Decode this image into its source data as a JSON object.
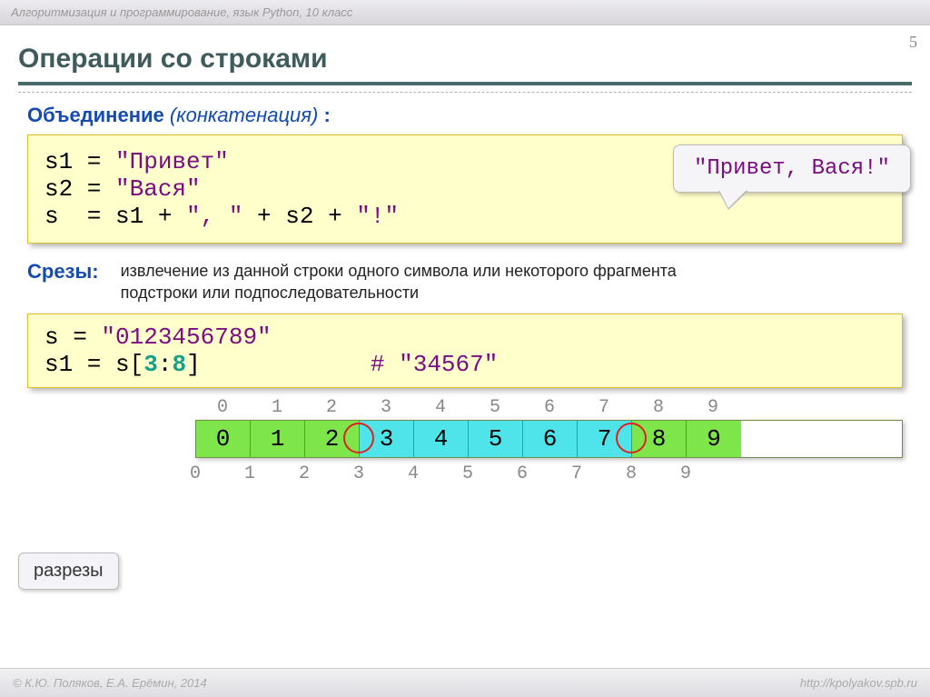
{
  "header": {
    "breadcrumb": "Алгоритмизация и программирование, язык Python, 10 класс",
    "page_number": "5"
  },
  "title": "Операции со строками",
  "concat": {
    "label_bold": "Объединение",
    "label_italic": "(конкатенация)",
    "label_tail": " :",
    "code_l1_a": "s1 = ",
    "code_l1_b": "\"Привет\"",
    "code_l2_a": "s2 = ",
    "code_l2_b": "\"Вася\"",
    "code_l3_a": "s  = s1 + ",
    "code_l3_b": "\", \"",
    "code_l3_c": " + s2 + ",
    "code_l3_d": "\"!\"",
    "callout": "\"Привет, Вася!\""
  },
  "slices": {
    "label": "Срезы:",
    "desc": "извлечение из данной строки одного символа или некоторого фрагмента подстроки или подпоследовательности",
    "code_l1_a": "s = ",
    "code_l1_b": "\"0123456789\"",
    "code_l2_a": "s1 = s",
    "code_l2_b": "[",
    "code_l2_c": "3",
    "code_l2_d": ":",
    "code_l2_e": "8",
    "code_l2_f": "]",
    "code_l2_spacer": "            ",
    "code_l2_comm": "# \"34567\""
  },
  "razrezy_label": "разрезы",
  "top_index": [
    "0",
    "1",
    "2",
    "3",
    "4",
    "5",
    "6",
    "7",
    "8",
    "9"
  ],
  "bottom_index": [
    "0",
    "1",
    "2",
    "3",
    "4",
    "5",
    "6",
    "7",
    "8",
    "9"
  ],
  "cells": [
    {
      "v": "0",
      "c": "green"
    },
    {
      "v": "1",
      "c": "green"
    },
    {
      "v": "2",
      "c": "green"
    },
    {
      "v": "3",
      "c": "cyan"
    },
    {
      "v": "4",
      "c": "cyan"
    },
    {
      "v": "5",
      "c": "cyan"
    },
    {
      "v": "6",
      "c": "cyan"
    },
    {
      "v": "7",
      "c": "cyan"
    },
    {
      "v": "8",
      "c": "green"
    },
    {
      "v": "9",
      "c": "green"
    }
  ],
  "footer": {
    "left": "© К.Ю. Поляков, Е.А. Ерёмин, 2014",
    "right": "http://kpolyakov.spb.ru"
  }
}
